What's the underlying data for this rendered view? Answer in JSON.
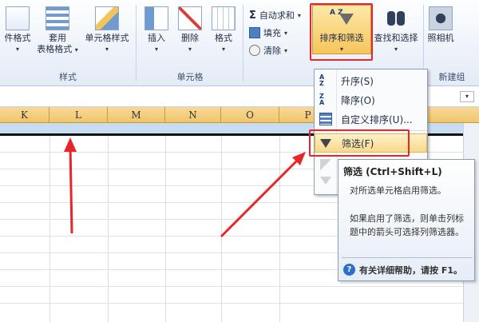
{
  "ribbon": {
    "buttons": {
      "cond_format": "件格式",
      "table_format_l1": "套用",
      "table_format_l2": "表格格式",
      "cell_style": "单元格样式",
      "insert": "插入",
      "delete": "删除",
      "format": "格式",
      "autosum": "自动求和",
      "fill": "填充",
      "clear": "清除",
      "sort_filter": "排序和筛选",
      "find_select": "查找和选择",
      "camera": "照相机"
    },
    "groups": {
      "styles": "样式",
      "cells": "单元格",
      "new_group": "新建组"
    },
    "symbols": {
      "sigma": "Σ",
      "caret": "▾",
      "sort_az": "A Z"
    }
  },
  "columns": [
    "K",
    "L",
    "M",
    "N",
    "O",
    "P"
  ],
  "menu": {
    "items": [
      {
        "label": "升序(S)",
        "icon": "sort-asc-icon"
      },
      {
        "label": "降序(O)",
        "icon": "sort-desc-icon"
      },
      {
        "label": "自定义排序(U)...",
        "icon": "custom-sort-icon"
      },
      {
        "label": "筛选(F)",
        "icon": "filter-icon",
        "highlighted": true
      }
    ]
  },
  "tooltip": {
    "title": "筛选 (Ctrl+Shift+L)",
    "line1": "对所选单元格启用筛选。",
    "line2": "如果启用了筛选，则单击列标题中的箭头可选择列筛选器。",
    "help": "有关详细帮助，请按 F1。",
    "help_icon": "?"
  },
  "colors": {
    "annotation": "#e8262a",
    "header": "#f0c56a",
    "selection_row": "#c8ddf1"
  }
}
